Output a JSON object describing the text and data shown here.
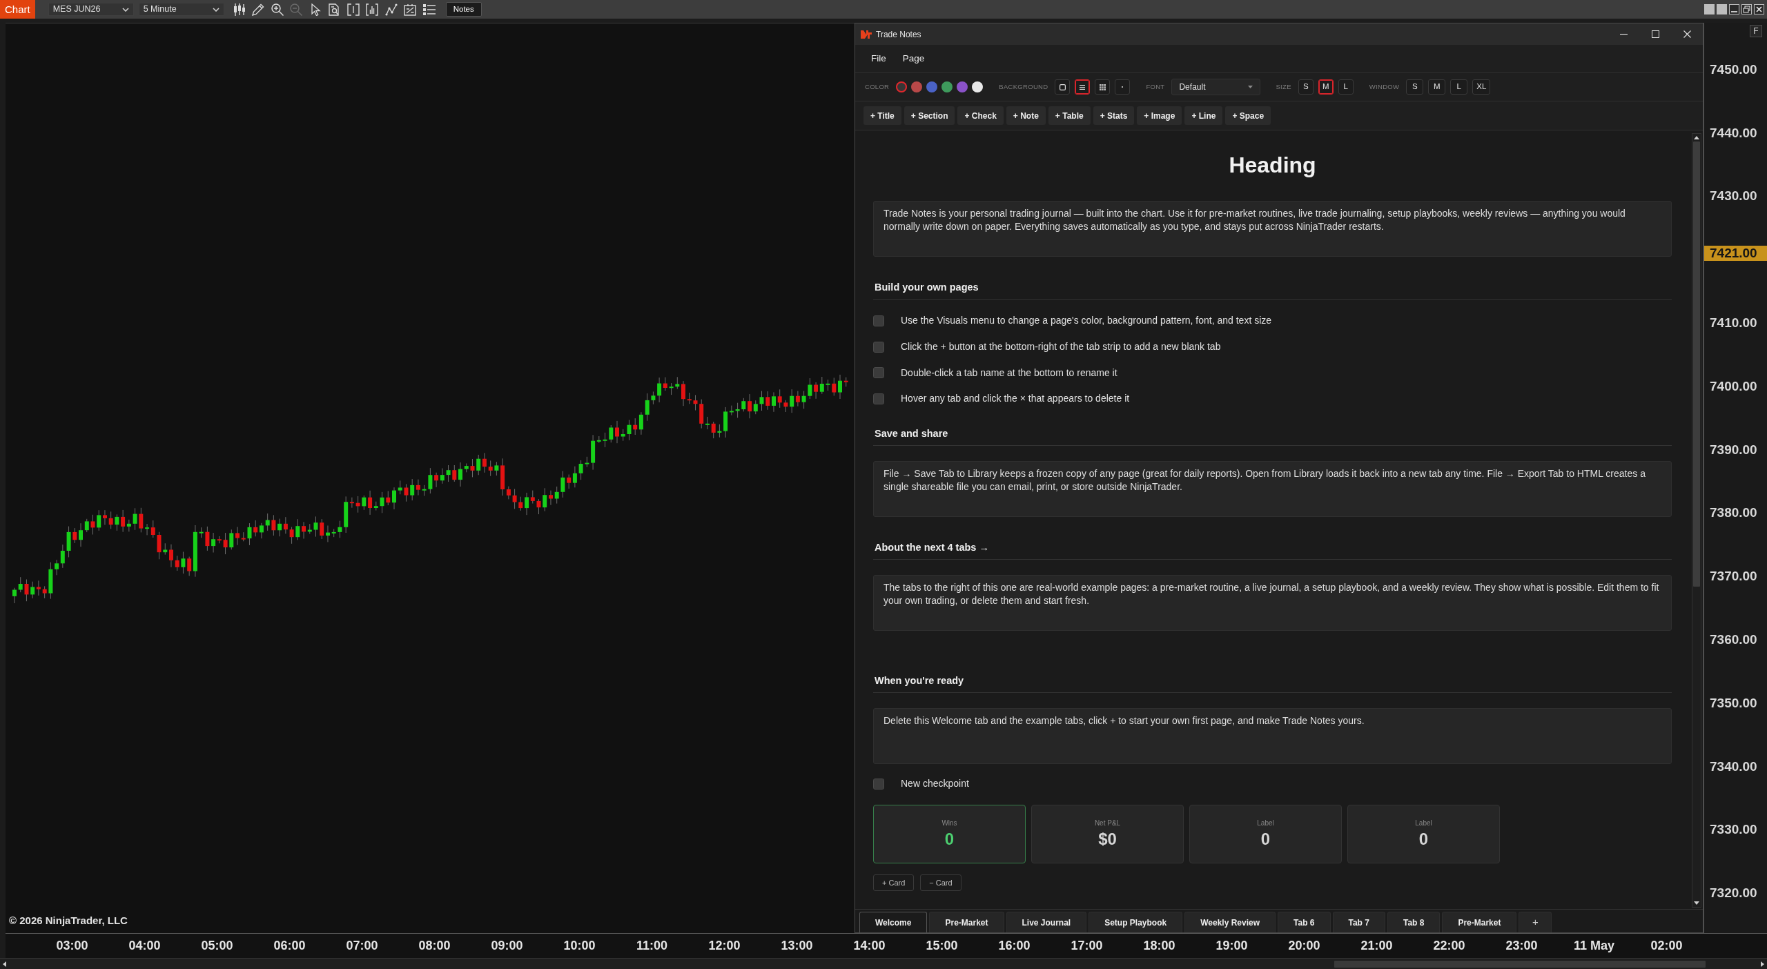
{
  "top_toolbar": {
    "app_button": "Chart",
    "instrument": "MES JUN26",
    "interval": "5 Minute",
    "tools": [
      {
        "kind": "bars",
        "disabled": false
      },
      {
        "kind": "pencil",
        "disabled": false
      },
      {
        "kind": "zoom_in",
        "disabled": false
      },
      {
        "kind": "zoom_out",
        "disabled": true
      },
      {
        "kind": "pointer",
        "disabled": false
      },
      {
        "kind": "inspect",
        "disabled": false
      },
      {
        "kind": "bracket",
        "disabled": false
      },
      {
        "kind": "volume",
        "disabled": false
      },
      {
        "kind": "line",
        "disabled": false
      },
      {
        "kind": "report",
        "disabled": false
      },
      {
        "kind": "list",
        "disabled": false
      }
    ],
    "notes_button": "Notes"
  },
  "chart": {
    "copyright": "© 2026 NinjaTrader, LLC",
    "price_axis": {
      "button": "F",
      "labels": [
        {
          "kind": "tick",
          "text": "7450.00"
        },
        {
          "kind": "tick",
          "text": "7440.00"
        },
        {
          "kind": "tick",
          "text": "7430.00"
        },
        {
          "kind": "last_price",
          "text": "7421.00"
        },
        {
          "kind": "tick",
          "text": "7410.00"
        },
        {
          "kind": "tick",
          "text": "7400.00"
        },
        {
          "kind": "tick",
          "text": "7390.00"
        },
        {
          "kind": "tick",
          "text": "7380.00"
        },
        {
          "kind": "tick",
          "text": "7370.00"
        },
        {
          "kind": "tick",
          "text": "7360.00"
        },
        {
          "kind": "tick",
          "text": "7350.00"
        },
        {
          "kind": "tick",
          "text": "7340.00"
        },
        {
          "kind": "tick",
          "text": "7330.00"
        },
        {
          "kind": "tick",
          "text": "7320.00"
        }
      ]
    },
    "time_axis": {
      "labels": [
        "03:00",
        "04:00",
        "05:00",
        "06:00",
        "07:00",
        "08:00",
        "09:00",
        "10:00",
        "11:00",
        "12:00",
        "13:00",
        "14:00",
        "15:00",
        "16:00",
        "17:00",
        "18:00",
        "19:00",
        "20:00",
        "21:00",
        "22:00",
        "23:00",
        "11 May",
        "02:00"
      ]
    }
  },
  "notes_window": {
    "title": "Trade Notes",
    "menu": [
      "File",
      "Page"
    ],
    "visuals": {
      "color": {
        "label": "COLOR",
        "swatches": [
          {
            "color": "#363636",
            "selected": true
          },
          {
            "color": "#b84848",
            "selected": false
          },
          {
            "color": "#4a62c6",
            "selected": false
          },
          {
            "color": "#3e9a5c",
            "selected": false
          },
          {
            "color": "#8a52c8",
            "selected": false
          },
          {
            "color": "#e8e8e8",
            "selected": false
          }
        ]
      },
      "background": {
        "label": "BACKGROUND",
        "options": [
          {
            "kind": "plain",
            "selected": false
          },
          {
            "kind": "lines",
            "selected": true
          },
          {
            "kind": "grid",
            "selected": false
          },
          {
            "kind": "dots",
            "selected": false
          }
        ]
      },
      "font": {
        "label": "FONT",
        "value": "Default"
      },
      "size": {
        "label": "SIZE",
        "options": [
          {
            "text": "S",
            "selected": false
          },
          {
            "text": "M",
            "selected": true
          },
          {
            "text": "L",
            "selected": false
          }
        ]
      },
      "window": {
        "label": "WINDOW",
        "options": [
          {
            "text": "S",
            "selected": false
          },
          {
            "text": "M",
            "selected": false
          },
          {
            "text": "L",
            "selected": false
          },
          {
            "text": "XL",
            "selected": false
          }
        ]
      }
    },
    "insert_buttons": [
      "+ Title",
      "+ Section",
      "+ Check",
      "+ Note",
      "+ Table",
      "+ Stats",
      "+ Image",
      "+ Line",
      "+ Space"
    ],
    "blocks": [
      {
        "kind": "title",
        "text": "Heading"
      },
      {
        "kind": "note",
        "text": "Trade Notes is your personal trading journal — built into the chart. Use it for pre-market routines, live trade journaling, setup playbooks, weekly reviews — anything you would normally write down on paper. Everything saves automatically as you type, and stays put across NinjaTrader restarts."
      },
      {
        "kind": "section",
        "text": "Build your own pages"
      },
      {
        "kind": "check",
        "text": "Use the Visuals menu to change a page's color, background pattern, font, and text size",
        "checked": false
      },
      {
        "kind": "check",
        "text": "Click the + button at the bottom-right of the tab strip to add a new blank tab",
        "checked": false
      },
      {
        "kind": "check",
        "text": "Double-click a tab name at the bottom to rename it",
        "checked": false
      },
      {
        "kind": "check",
        "text": "Hover any tab and click the × that appears to delete it",
        "checked": false
      },
      {
        "kind": "section",
        "text": "Save and share"
      },
      {
        "kind": "note",
        "text": "File → Save Tab to Library keeps a frozen copy of any page (great for daily reports). Open from Library loads it back into a new tab any time. File → Export Tab to HTML creates a single shareable file you can email, print, or store outside NinjaTrader."
      },
      {
        "kind": "section",
        "text": "About the next 4 tabs →"
      },
      {
        "kind": "note",
        "text": "The tabs to the right of this one are real-world example pages: a pre-market routine, a live journal, a setup playbook, and a weekly review. They show what is possible. Edit them to fit your own trading, or delete them and start fresh."
      },
      {
        "kind": "space"
      },
      {
        "kind": "section",
        "text": "When you're ready"
      },
      {
        "kind": "note",
        "text": "Delete this Welcome tab and the example tabs, click + to start your own first page, and make Trade Notes yours."
      },
      {
        "kind": "check",
        "text": "New checkpoint",
        "checked": false
      },
      {
        "kind": "stats",
        "cards": [
          {
            "label": "Wins",
            "value": "0",
            "color": "#4ccf70",
            "highlighted": true
          },
          {
            "label": "Net P&L",
            "value": "$0",
            "color": "#d6d6d6",
            "highlighted": false
          },
          {
            "label": "Label",
            "value": "0",
            "color": "#d6d6d6",
            "highlighted": false
          },
          {
            "label": "Label",
            "value": "0",
            "color": "#d6d6d6",
            "highlighted": false
          }
        ],
        "buttons": [
          "+ Card",
          "− Card"
        ]
      }
    ],
    "tabs": [
      {
        "label": "Welcome",
        "selected": true
      },
      {
        "label": "Pre-Market",
        "selected": false
      },
      {
        "label": "Live Journal",
        "selected": false
      },
      {
        "label": "Setup Playbook",
        "selected": false
      },
      {
        "label": "Weekly Review",
        "selected": false
      },
      {
        "label": "Tab 6",
        "selected": false
      },
      {
        "label": "Tab 7",
        "selected": false
      },
      {
        "label": "Tab 8",
        "selected": false
      },
      {
        "label": "Pre-Market",
        "selected": false
      }
    ],
    "add_tab_button": "+"
  }
}
